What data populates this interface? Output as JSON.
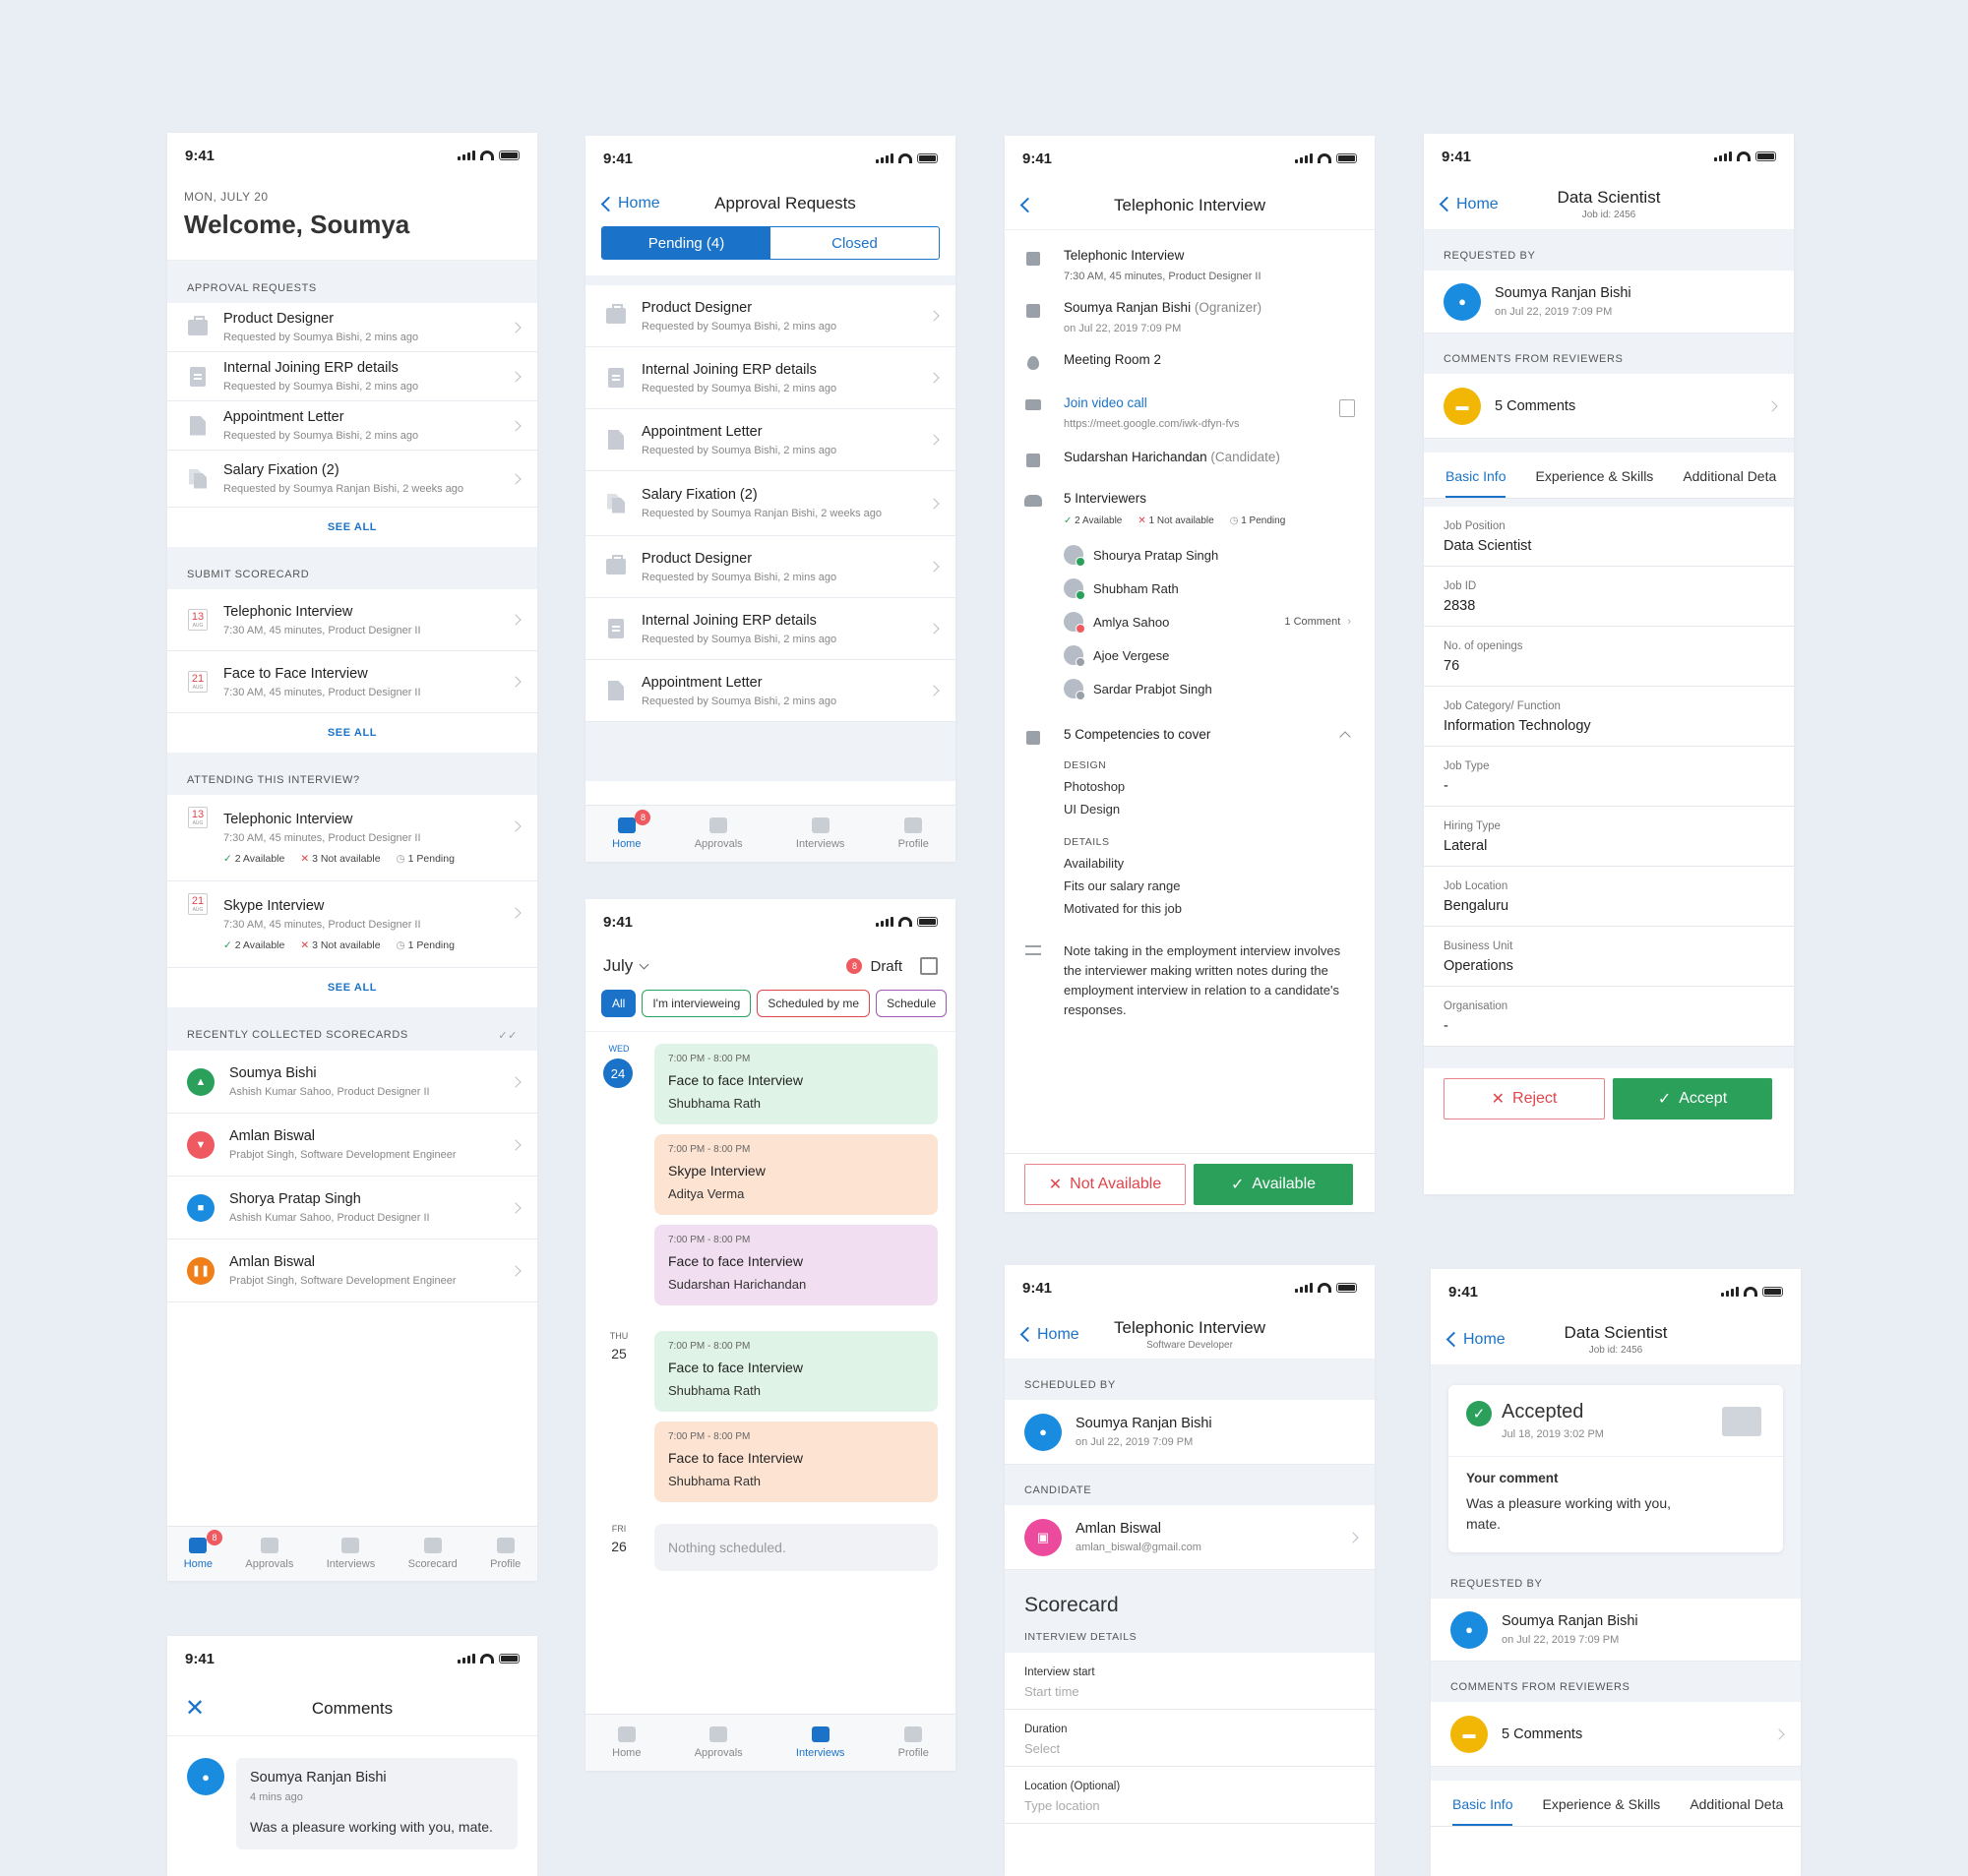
{
  "status_time": "9:41",
  "home": {
    "date": "MON, JULY 20",
    "welcome": "Welcome, Soumya",
    "approval_heading": "APPROVAL REQUESTS",
    "approvals": [
      {
        "title": "Product Designer",
        "sub": "Requested by Soumya Bishi, 2 mins ago",
        "icon": "briefcase-icon"
      },
      {
        "title": "Internal Joining ERP details",
        "sub": "Requested by Soumya Bishi, 2 mins ago",
        "icon": "clipboard-icon"
      },
      {
        "title": "Appointment Letter",
        "sub": "Requested by Soumya Bishi, 2 mins ago",
        "icon": "document-icon"
      },
      {
        "title": "Salary Fixation (2)",
        "sub": "Requested by Soumya Ranjan Bishi, 2 weeks ago",
        "icon": "documents-icon"
      }
    ],
    "see_all": "SEE ALL",
    "scorecard_heading": "SUBMIT SCORECARD",
    "scorecards": [
      {
        "day": "13",
        "month": "AUG",
        "title": "Telephonic Interview",
        "sub": "7:30 AM, 45 minutes, Product Designer II"
      },
      {
        "day": "21",
        "month": "AUG",
        "title": "Face to Face Interview",
        "sub": "7:30 AM, 45 minutes, Product Designer II"
      }
    ],
    "attending_heading": "ATTENDING THIS INTERVIEW?",
    "attending": [
      {
        "day": "13",
        "month": "AUG",
        "title": "Telephonic Interview",
        "sub": "7:30 AM, 45 minutes, Product Designer II",
        "available": "2 Available",
        "not_available": "3 Not available",
        "pending": "1 Pending"
      },
      {
        "day": "21",
        "month": "AUG",
        "title": "Skype Interview",
        "sub": "7:30 AM, 45 minutes, Product Designer II",
        "available": "2 Available",
        "not_available": "3 Not available",
        "pending": "1 Pending"
      }
    ],
    "recent_heading": "RECENTLY COLLECTED SCORECARDS",
    "recent": [
      {
        "name": "Soumya Bishi",
        "sub": "Ashish Kumar Sahoo, Product Designer II",
        "color": "#2aa05a",
        "icon": "thumbs-up-icon"
      },
      {
        "name": "Amlan Biswal",
        "sub": "Prabjot Singh, Software Development Engineer",
        "color": "#ee5a5f",
        "icon": "thumbs-down-icon"
      },
      {
        "name": "Shorya Pratap Singh",
        "sub": "Ashish Kumar Sahoo, Product Designer II",
        "color": "#1a8ce0",
        "icon": "briefcase-icon"
      },
      {
        "name": "Amlan Biswal",
        "sub": "Prabjot Singh, Software Development Engineer",
        "color": "#f07f1a",
        "icon": "pause-icon"
      }
    ],
    "tabs": [
      "Home",
      "Approvals",
      "Interviews",
      "Scorecard",
      "Profile"
    ],
    "badge": "8"
  },
  "approval_requests": {
    "back": "Home",
    "title": "Approval Requests",
    "seg_pending": "Pending (4)",
    "seg_closed": "Closed",
    "items": [
      {
        "title": "Product Designer",
        "sub": "Requested by Soumya Bishi, 2 mins ago"
      },
      {
        "title": "Internal Joining ERP details",
        "sub": "Requested by Soumya Bishi, 2 mins ago"
      },
      {
        "title": "Appointment Letter",
        "sub": "Requested by Soumya Bishi, 2 mins ago"
      },
      {
        "title": "Salary Fixation (2)",
        "sub": "Requested by Soumya Ranjan Bishi, 2 weeks ago"
      },
      {
        "title": "Product Designer",
        "sub": "Requested by Soumya Bishi, 2 mins ago"
      },
      {
        "title": "Internal Joining ERP details",
        "sub": "Requested by Soumya Bishi, 2 mins ago"
      },
      {
        "title": "Appointment Letter",
        "sub": "Requested by Soumya Bishi, 2 mins ago"
      }
    ],
    "tabs": [
      "Home",
      "Approvals",
      "Interviews",
      "Profile"
    ],
    "badge": "8"
  },
  "calendar": {
    "month": "July",
    "draft_count": "8",
    "draft": "Draft",
    "chips": [
      "All",
      "I'm intervieweing",
      "Scheduled by me",
      "Schedule"
    ],
    "days": [
      {
        "dow": "WED",
        "day": "24",
        "events": [
          {
            "time": "7:00 PM - 8:00 PM",
            "name": "Face to face Interview",
            "person": "Shubhama Rath",
            "color": "#dff3e6"
          },
          {
            "time": "7:00 PM - 8:00 PM",
            "name": "Skype Interview",
            "person": "Aditya Verma",
            "color": "#fde3d2"
          },
          {
            "time": "7:00 PM - 8:00 PM",
            "name": "Face to face Interview",
            "person": "Sudarshan Harichandan",
            "color": "#f1def0"
          }
        ]
      },
      {
        "dow": "THU",
        "day": "25",
        "events": [
          {
            "time": "7:00 PM - 8:00 PM",
            "name": "Face to face Interview",
            "person": "Shubhama Rath",
            "color": "#dff3e6"
          },
          {
            "time": "7:00 PM - 8:00 PM",
            "name": "Face to face Interview",
            "person": "Shubhama Rath",
            "color": "#fde3d2"
          }
        ]
      },
      {
        "dow": "FRI",
        "day": "26",
        "empty": "Nothing scheduled."
      }
    ],
    "tabs": [
      "Home",
      "Approvals",
      "Interviews",
      "Profile"
    ]
  },
  "interview": {
    "title": "Telephonic Interview",
    "name": "Telephonic Interview",
    "name_sub": "7:30 AM, 45 minutes, Product Designer II",
    "organiser": "Soumya Ranjan Bishi",
    "organiser_role": "(Ogranizer)",
    "organiser_date": "on Jul 22, 2019 7:09 PM",
    "room": "Meeting Room 2",
    "video_label": "Join video call",
    "video_url": "https://meet.google.com/iwk-dfyn-fvs",
    "candidate": "Sudarshan Harichandan",
    "candidate_role": "(Candidate)",
    "interviewers_label": "5 Interviewers",
    "available": "2 Available",
    "not_available": "1 Not available",
    "pending": "1 Pending",
    "interviewers": [
      {
        "name": "Shourya Pratap Singh",
        "status": "#2aa05a",
        "note": ""
      },
      {
        "name": "Shubham Rath",
        "status": "#2aa05a",
        "note": ""
      },
      {
        "name": "Amlya Sahoo",
        "status": "#ee5a5f",
        "note": "1 Comment"
      },
      {
        "name": "Ajoe Vergese",
        "status": "#9aa0a8",
        "note": ""
      },
      {
        "name": "Sardar Prabjot Singh",
        "status": "#9aa0a8",
        "note": ""
      }
    ],
    "competencies_label": "5 Competencies to cover",
    "design_heading": "DESIGN",
    "design": [
      "Photoshop",
      "UI Design"
    ],
    "details_heading": "DETAILS",
    "details": [
      "Availability",
      "Fits our salary range",
      "Motivated for this job"
    ],
    "note": "Note taking in the employment interview involves the interviewer making written notes during the employment interview in relation to a candidate's responses.",
    "not_available_btn": "Not Available",
    "available_btn": "Available"
  },
  "job": {
    "back": "Home",
    "title": "Data Scientist",
    "job_id": "Job id: 2456",
    "requested_heading": "REQUESTED BY",
    "requester": "Soumya Ranjan Bishi",
    "requester_date": "on Jul 22, 2019 7:09 PM",
    "comments_heading": "COMMENTS FROM REVIEWERS",
    "comments": "5 Comments",
    "tabs": [
      "Basic Info",
      "Experience & Skills",
      "Additional Deta"
    ],
    "fields": [
      {
        "label": "Job Position",
        "value": "Data Scientist"
      },
      {
        "label": "Job ID",
        "value": "2838"
      },
      {
        "label": "No. of openings",
        "value": "76"
      },
      {
        "label": "Job Category/ Function",
        "value": "Information Technology"
      },
      {
        "label": "Job Type",
        "value": "-"
      },
      {
        "label": "Hiring Type",
        "value": "Lateral"
      },
      {
        "label": "Job Location",
        "value": "Bengaluru"
      },
      {
        "label": "Business Unit",
        "value": "Operations"
      },
      {
        "label": "Organisation",
        "value": "-"
      }
    ],
    "reject": "Reject",
    "accept": "Accept"
  },
  "comments_screen": {
    "title": "Comments",
    "author": "Soumya Ranjan Bishi",
    "time": "4 mins ago",
    "text": "Was a pleasure working with you, mate."
  },
  "scorecard_screen": {
    "back": "Home",
    "title": "Telephonic Interview",
    "subtitle": "Software Developer",
    "scheduled_heading": "SCHEDULED BY",
    "scheduler": "Soumya Ranjan Bishi",
    "scheduler_date": "on Jul 22, 2019 7:09 PM",
    "candidate_heading": "CANDIDATE",
    "candidate": "Amlan Biswal",
    "candidate_email": "amlan_biswal@gmail.com",
    "scorecard_title": "Scorecard",
    "details_heading": "INTERVIEW DETAILS",
    "fields": [
      {
        "label": "Interview start",
        "placeholder": "Start time"
      },
      {
        "label": "Duration",
        "placeholder": "Select"
      },
      {
        "label": "Location (Optional)",
        "placeholder": "Type location"
      }
    ]
  },
  "accepted_screen": {
    "back": "Home",
    "title": "Data Scientist",
    "job_id": "Job id: 2456",
    "status": "Accepted",
    "status_date": "Jul 18, 2019 3:02 PM",
    "your_comment": "Your comment",
    "comment": "Was a pleasure working with you, mate.",
    "requested_heading": "REQUESTED BY",
    "requester": "Soumya Ranjan Bishi",
    "requester_date": "on Jul 22, 2019 7:09 PM",
    "comments_heading": "COMMENTS FROM REVIEWERS",
    "comments": "5 Comments",
    "tabs": [
      "Basic Info",
      "Experience & Skills",
      "Additional Deta"
    ]
  },
  "colors": {
    "accent": "#1a73c8",
    "success": "#2aa05a",
    "danger": "#e0454b",
    "background": "#e9edf4"
  }
}
